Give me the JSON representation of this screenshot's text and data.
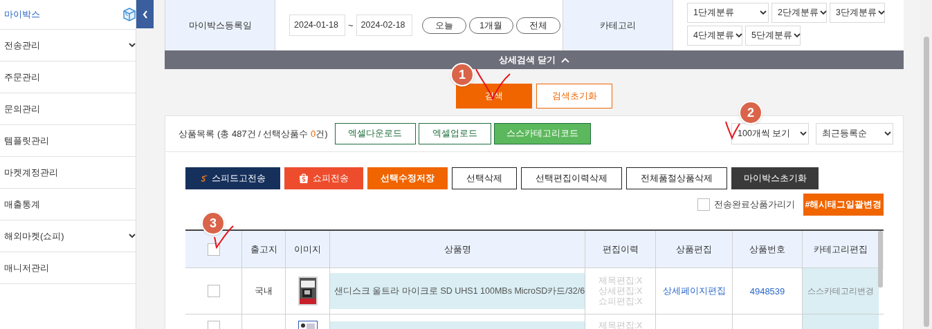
{
  "sidebar": {
    "items": [
      {
        "label": "마이박스",
        "selected": true,
        "has_submenu": false
      },
      {
        "label": "전송관리",
        "selected": false,
        "has_submenu": true
      },
      {
        "label": "주문관리",
        "selected": false,
        "has_submenu": false
      },
      {
        "label": "문의관리",
        "selected": false,
        "has_submenu": false
      },
      {
        "label": "템플릿관리",
        "selected": false,
        "has_submenu": false
      },
      {
        "label": "마켓계정관리",
        "selected": false,
        "has_submenu": false
      },
      {
        "label": "매출통계",
        "selected": false,
        "has_submenu": false
      },
      {
        "label": "해외마켓(쇼피)",
        "selected": false,
        "has_submenu": true
      },
      {
        "label": "매니저관리",
        "selected": false,
        "has_submenu": false
      }
    ]
  },
  "search": {
    "date_label": "마이박스등록일",
    "date_from": "2024-01-18",
    "date_separator": "~",
    "date_to": "2024-02-18",
    "range_buttons": [
      "오늘",
      "1개월",
      "전체"
    ],
    "category_label": "카테고리",
    "category_selects": [
      "1단계분류",
      "2단계분류",
      "3단계분류",
      "4단계분류",
      "5단계분류"
    ],
    "toggle_label": "상세검색 닫기",
    "search_button": "검색",
    "reset_button": "검색초기화"
  },
  "product_list": {
    "title": "상품목록",
    "summary_start": "(총 487건 / 선택상품수 ",
    "selected_count": "0",
    "summary_end": "건)",
    "header_buttons": [
      {
        "label": "엑셀다운로드",
        "kind": "outline"
      },
      {
        "label": "엑셀업로드",
        "kind": "outline"
      },
      {
        "label": "스스카테고리코드",
        "kind": "green"
      }
    ],
    "selects": [
      "100개씩 보기",
      "최근등록순"
    ],
    "action_buttons": [
      {
        "label": "스피드고전송",
        "kind": "speedgo"
      },
      {
        "label": "쇼피전송",
        "kind": "shopee"
      },
      {
        "label": "선택수정저장",
        "kind": "orange"
      },
      {
        "label": "선택삭제",
        "kind": "outline"
      },
      {
        "label": "선택편집이력삭제",
        "kind": "outline"
      },
      {
        "label": "전체품절상품삭제",
        "kind": "outline"
      },
      {
        "label": "마이박스초기화",
        "kind": "dark"
      }
    ],
    "hide_sent": {
      "label": "전송완료상품가리기",
      "checked": false
    },
    "hashtag_button": "#해시태그일괄변경"
  },
  "table": {
    "header_checked": false,
    "columns": [
      "출고지",
      "이미지",
      "상품명",
      "편집이력",
      "상품편집",
      "상품번호",
      "카테고리편집"
    ],
    "rows": [
      {
        "checked": false,
        "origin": "국내",
        "image": {
          "kind": "picture"
        },
        "name": "샌디스크 울트라 마이크로 SD UHS1 100MBs MicroSD카드/32/6",
        "edit_history": [
          "제목편집:X",
          "상세편집:X",
          "쇼피편집:X"
        ],
        "edit_link": "상세페이지편집",
        "product_no": "4948539",
        "category_action": "스스카테고리변경"
      },
      {
        "checked": false,
        "image": {
          "kind": "picture"
        },
        "edit_history": [
          "제목편집:X"
        ]
      }
    ]
  },
  "annotations": [
    {
      "label": "1"
    },
    {
      "label": "2"
    },
    {
      "label": "3"
    }
  ]
}
